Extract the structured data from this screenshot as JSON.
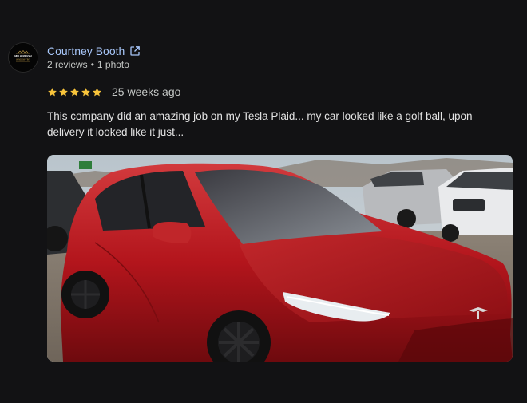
{
  "reviewer": {
    "name": "Courtney Booth",
    "review_count": "2 reviews",
    "photo_count": "1 photo",
    "separator": "•",
    "avatar_text_top": "MN & REIGN",
    "avatar_text_bottom": "WINDOW TINT"
  },
  "review": {
    "stars": 5,
    "star_color": "#f8c43b",
    "time_ago": "25 weeks ago",
    "text": "This company did an amazing job on my Tesla Plaid... my car looked like a golf ball, upon delivery it looked like it just..."
  },
  "icons": {
    "external_link": "open-in-new-icon",
    "star": "star-icon"
  },
  "colors": {
    "background": "#121214",
    "link": "#a8c7fa",
    "text": "#e3e3e3",
    "muted": "#c4c7c5",
    "car": "#b3151c"
  }
}
